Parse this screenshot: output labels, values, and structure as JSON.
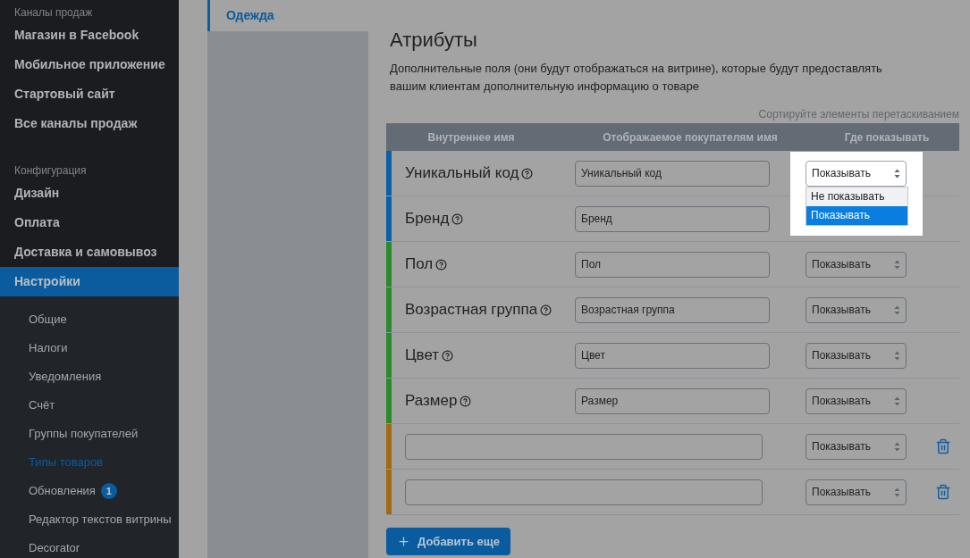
{
  "sidebar": {
    "sections": [
      {
        "title": "Каналы продаж",
        "items": [
          {
            "label": "Магазин в Facebook",
            "selected": false
          },
          {
            "label": "Мобильное приложение",
            "selected": false
          },
          {
            "label": "Стартовый сайт",
            "selected": false
          },
          {
            "label": "Все каналы продаж",
            "selected": false
          }
        ]
      },
      {
        "title": "Конфигурация",
        "items": [
          {
            "label": "Дизайн",
            "selected": false
          },
          {
            "label": "Оплата",
            "selected": false
          },
          {
            "label": "Доставка и самовывоз",
            "selected": false
          },
          {
            "label": "Настройки",
            "selected": true,
            "expanded": true,
            "children": [
              {
                "label": "Общие",
                "selected": false
              },
              {
                "label": "Налоги",
                "selected": false
              },
              {
                "label": "Уведомления",
                "selected": false
              },
              {
                "label": "Счёт",
                "selected": false
              },
              {
                "label": "Группы покупателей",
                "selected": false
              },
              {
                "label": "Типы товаров",
                "selected": true
              },
              {
                "label": "Обновления",
                "selected": false,
                "badge": "1"
              },
              {
                "label": "Редактор текстов витрины",
                "selected": false
              },
              {
                "label": "Decorator",
                "selected": false
              }
            ]
          }
        ]
      }
    ]
  },
  "product_types": [
    {
      "label": "Одежда",
      "selected": true
    }
  ],
  "attributes": {
    "title": "Атрибуты",
    "description": "Дополнительные поля (они будут отображаться на витрине), которые будут предоставлять вашим клиентам дополнительную информацию о товаре",
    "sort_hint": "Сортируйте элементы перетаскиванием",
    "columns": [
      "Внутреннее имя",
      "Отображаемое покупателям имя",
      "Где показывать"
    ],
    "rows": [
      {
        "kind": "fixed",
        "color": "#0a60a8",
        "name": "Уникальный код",
        "display_name": "Уникальный код",
        "show": {
          "value": "Показывать",
          "open": true,
          "options": [
            {
              "label": "Не показывать",
              "selected": false
            },
            {
              "label": "Показывать",
              "selected": true
            }
          ]
        }
      },
      {
        "kind": "fixed",
        "color": "#0a60a8",
        "name": "Бренд",
        "display_name": "Бренд"
      },
      {
        "kind": "fixed",
        "color": "#2b8a2b",
        "name": "Пол",
        "display_name": "Пол",
        "show": {
          "value": "Показывать",
          "open": false
        }
      },
      {
        "kind": "fixed",
        "color": "#2b8a2b",
        "name": "Возрастная группа",
        "display_name": "Возрастная группа",
        "show": {
          "value": "Показывать",
          "open": false
        }
      },
      {
        "kind": "fixed",
        "color": "#2b8a2b",
        "name": "Цвет",
        "display_name": "Цвет",
        "show": {
          "value": "Показывать",
          "open": false
        }
      },
      {
        "kind": "fixed",
        "color": "#2b8a2b",
        "name": "Размер",
        "display_name": "Размер",
        "show": {
          "value": "Показывать",
          "open": false
        }
      },
      {
        "kind": "custom",
        "color": "#a06a10",
        "show": {
          "value": "Показывать",
          "open": false
        }
      },
      {
        "kind": "custom",
        "color": "#a06a10",
        "show": {
          "value": "Показывать",
          "open": false
        }
      }
    ],
    "add_button": "Добавить еще"
  }
}
